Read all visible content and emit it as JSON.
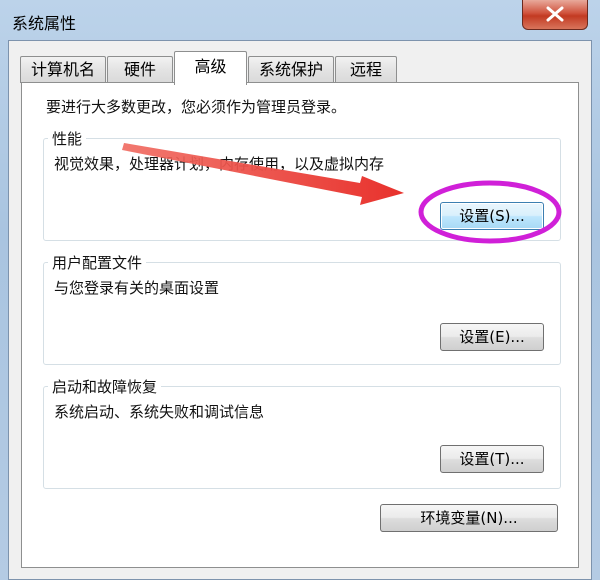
{
  "window": {
    "title": "系统属性"
  },
  "tabs": [
    {
      "label": "计算机名"
    },
    {
      "label": "硬件"
    },
    {
      "label": "高级"
    },
    {
      "label": "系统保护"
    },
    {
      "label": "远程"
    }
  ],
  "active_tab": "高级",
  "intro_text": "要进行大多数更改，您必须作为管理员登录。",
  "performance": {
    "title": "性能",
    "description": "视觉效果，处理器计划，内存使用，以及虚拟内存",
    "button_label": "设置(S)..."
  },
  "user_profiles": {
    "title": "用户配置文件",
    "description": "与您登录有关的桌面设置",
    "button_label": "设置(E)..."
  },
  "startup_recovery": {
    "title": "启动和故障恢复",
    "description": "系统启动、系统失败和调试信息",
    "button_label": "设置(T)..."
  },
  "env_button_label": "环境变量(N)...",
  "annotation": {
    "arrow_color": "#e8312c",
    "highlight_color": "#d020d8"
  }
}
